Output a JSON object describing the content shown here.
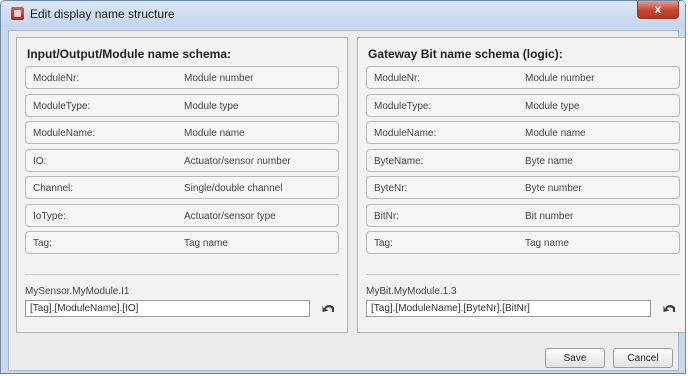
{
  "window": {
    "title": "Edit display name structure",
    "close_label": "x"
  },
  "left_panel": {
    "title": "Input/Output/Module name schema:",
    "rows": [
      {
        "key": "ModuleNr:",
        "value": "Module number"
      },
      {
        "key": "ModuleType:",
        "value": "Module type"
      },
      {
        "key": "ModuleName:",
        "value": "Module name"
      },
      {
        "key": "IO:",
        "value": "Actuator/sensor number"
      },
      {
        "key": "Channel:",
        "value": "Single/double channel"
      },
      {
        "key": "IoType:",
        "value": "Actuator/sensor type"
      },
      {
        "key": "Tag:",
        "value": "Tag name"
      }
    ],
    "example": "MySensor.MyModule.I1",
    "schema": "[Tag].[ModuleName].[IO]"
  },
  "right_panel": {
    "title": "Gateway Bit name schema (logic):",
    "rows": [
      {
        "key": "ModuleNr:",
        "value": "Module number"
      },
      {
        "key": "ModuleType:",
        "value": "Module type"
      },
      {
        "key": "ModuleName:",
        "value": "Module name"
      },
      {
        "key": "ByteName:",
        "value": "Byte name"
      },
      {
        "key": "ByteNr:",
        "value": "Byte number"
      },
      {
        "key": "BitNr:",
        "value": "Bit number"
      },
      {
        "key": "Tag:",
        "value": "Tag name"
      }
    ],
    "example": "MyBit.MyModule.1.3",
    "schema": "[Tag].[ModuleName].[ByteNr].[BitNr]"
  },
  "buttons": {
    "save": "Save",
    "cancel": "Cancel"
  },
  "icons": {
    "app": "app-icon",
    "undo": "undo-icon"
  },
  "colors": {
    "titlebar": "#c7d9ee",
    "close": "#c8452f",
    "panel_bg": "#f3f3f3"
  }
}
